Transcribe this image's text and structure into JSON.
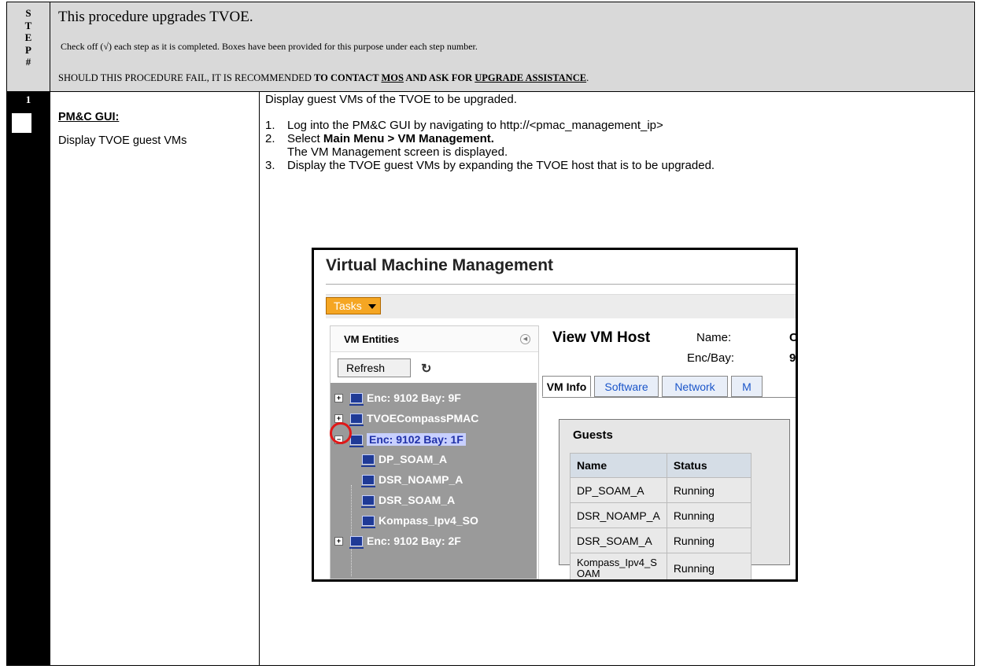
{
  "header": {
    "step_letters": [
      "S",
      "T",
      "E",
      "P",
      "#"
    ],
    "title": "This procedure upgrades TVOE.",
    "check_note": "Check off (√) each step as it is completed. Boxes have been provided for this purpose under each step number.",
    "fail_prefix": "SHOULD THIS PROCEDURE FAIL, IT IS RECOMMENDED ",
    "fail_b1": "TO CONTACT ",
    "fail_b2": "MOS",
    "fail_b3": " AND ",
    "fail_b4": "ASK FOR ",
    "fail_b5": "UPGRADE ASSISTANCE",
    "fail_end": "."
  },
  "step": {
    "number": "1",
    "tag": "PM&C GUI:",
    "description": "Display TVOE guest VMs",
    "intro": "Display guest VMs of the TVOE to be upgraded.",
    "items": [
      {
        "n": "1.",
        "text": "Log into the PM&C GUI by navigating to http://<pmac_management_ip>"
      },
      {
        "n": "2.",
        "pre": "Select ",
        "bold": "Main Menu > VM Management.",
        "sub": "The VM Management screen is displayed."
      },
      {
        "n": "3.",
        "text": "Display the TVOE guest VMs by expanding the TVOE host that is to be upgraded."
      }
    ]
  },
  "screenshot": {
    "title": "Virtual Machine Management",
    "tasks_label": "Tasks",
    "entities_title": "VM Entities",
    "refresh_label": "Refresh",
    "tree": [
      {
        "label": "Enc: 9102 Bay: 9F",
        "expander": "+"
      },
      {
        "label": "TVOECompassPMAC",
        "expander": "+"
      },
      {
        "label": "Enc: 9102 Bay: 1F",
        "expander": "−"
      },
      {
        "label": "DP_SOAM_A"
      },
      {
        "label": "DSR_NOAMP_A"
      },
      {
        "label": "DSR_SOAM_A"
      },
      {
        "label": "Kompass_Ipv4_SO"
      },
      {
        "label": "Enc: 9102 Bay: 2F",
        "expander": "+"
      }
    ],
    "host_title": "View VM Host",
    "name_label": "Name:",
    "name_value": "C",
    "enc_label": "Enc/Bay:",
    "enc_value": "9",
    "tabs": [
      "VM Info",
      "Software",
      "Network",
      "M"
    ],
    "guests_title": "Guests",
    "col_name": "Name",
    "col_status": "Status",
    "guests": [
      {
        "name": "DP_SOAM_A",
        "status": "Running"
      },
      {
        "name": "DSR_NOAMP_A",
        "status": "Running"
      },
      {
        "name": "DSR_SOAM_A",
        "status": "Running"
      },
      {
        "name": "Kompass_Ipv4_S OAM",
        "status": "Running"
      }
    ]
  }
}
